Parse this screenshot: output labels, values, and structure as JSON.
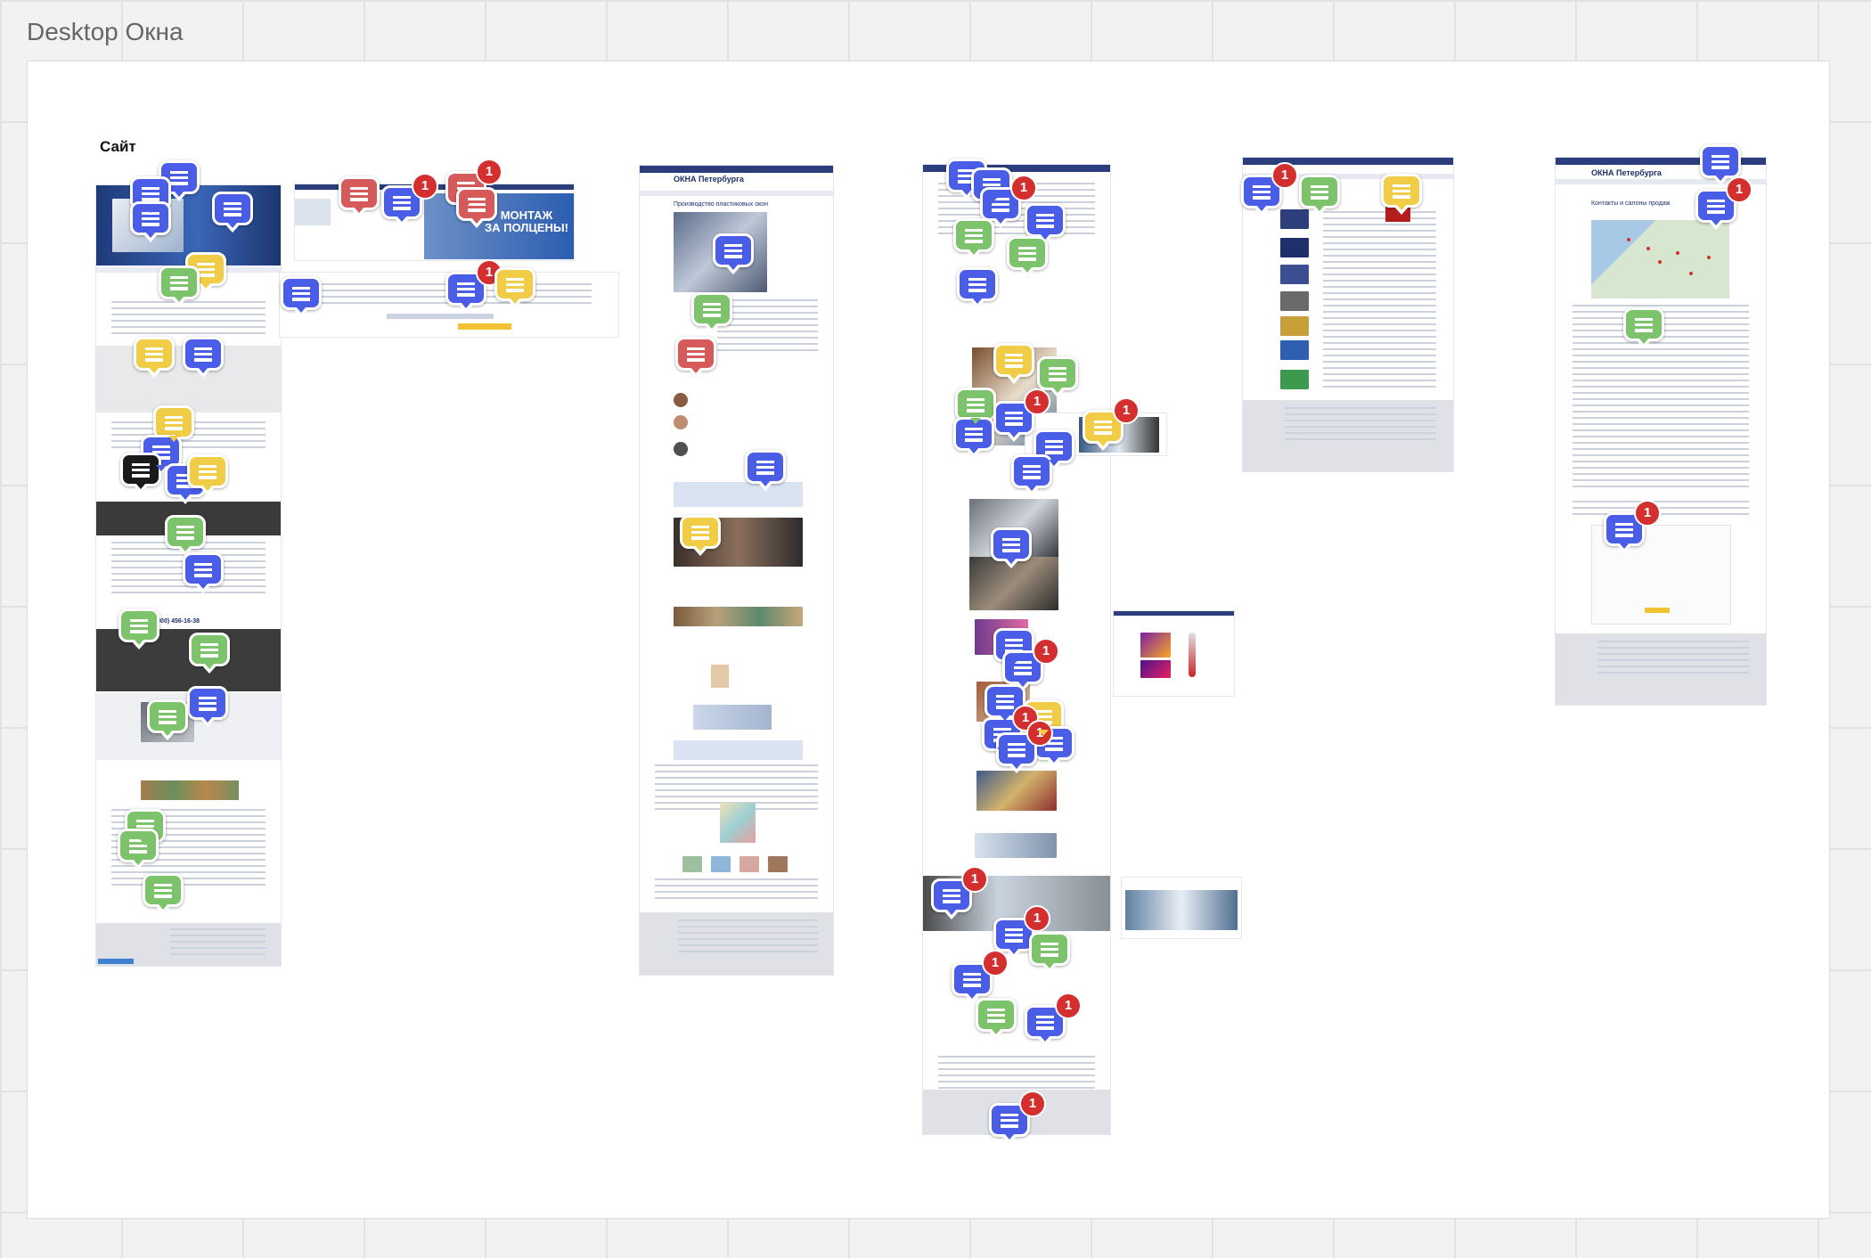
{
  "frame": {
    "title": "Desktop Окна",
    "section_label": "Сайт"
  },
  "pages": {
    "home": {
      "hero_text": "МОНТАЖ\nЗА ПОЛЦЕНЫ!",
      "phone": "8 (800) 456-16-38"
    },
    "product": {
      "logo": "ОКНА Петербурга",
      "heading": "Производство пластиковых окон"
    },
    "contacts": {
      "logo": "ОКНА Петербурга",
      "heading": "Контакты и салоны продаж"
    }
  },
  "comment_badge_count": "1",
  "colors": {
    "blue": "#4a5de6",
    "green": "#7dc36b",
    "yellow": "#f1cc46",
    "red": "#d75a5a",
    "badge": "#d32f2f",
    "site_navy": "#2b3d7a"
  },
  "icons": {
    "comment": "comment-icon",
    "badge": "notification-badge"
  }
}
